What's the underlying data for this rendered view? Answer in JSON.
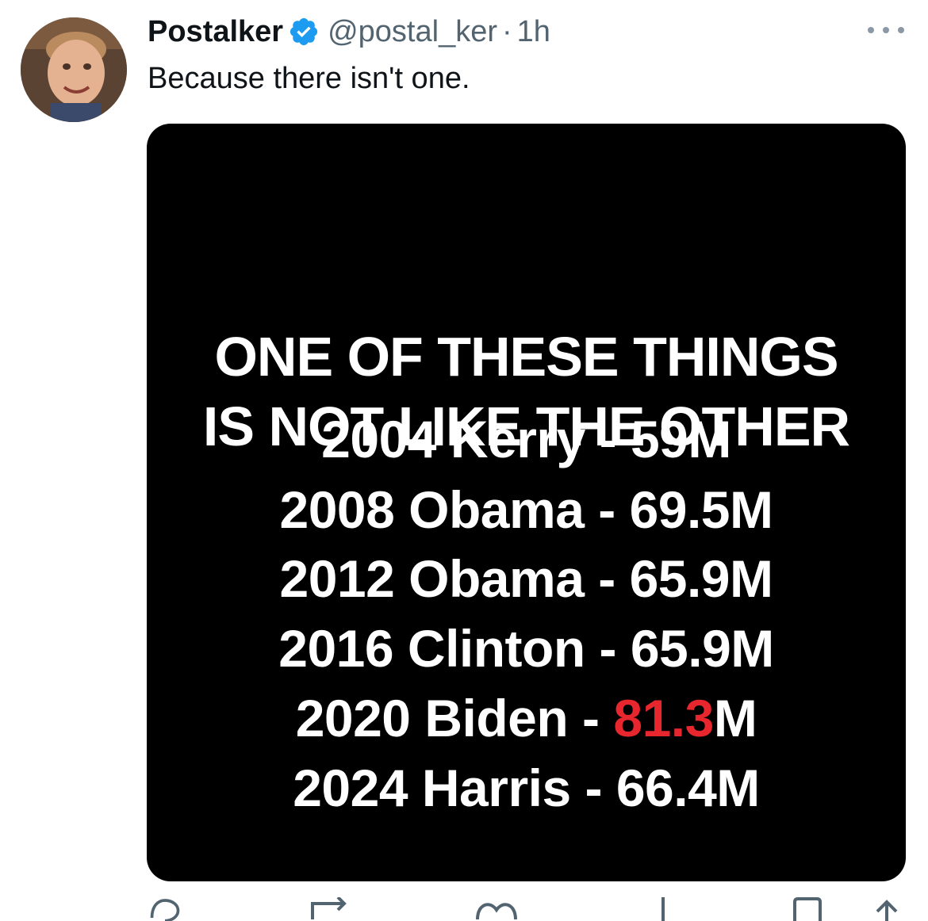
{
  "tweet": {
    "display_name": "Postalker",
    "handle": "@postal_ker",
    "separator": "·",
    "time": "1h",
    "text": "Because there isn't one."
  },
  "image": {
    "title_lines": [
      "ONE OF THESE THINGS",
      "IS NOT LIKE THE OTHER"
    ],
    "results": [
      {
        "year": "2004",
        "candidate": "Kerry",
        "votes_plain": "59M"
      },
      {
        "year": "2008",
        "candidate": "Obama",
        "votes_plain": "69.5M"
      },
      {
        "year": "2012",
        "candidate": "Obama",
        "votes_plain": "65.9M"
      },
      {
        "year": "2016",
        "candidate": "Clinton",
        "votes_plain": "65.9M"
      },
      {
        "year": "2020",
        "candidate": "Biden",
        "votes_highlight": "81.3",
        "votes_suffix": "M"
      },
      {
        "year": "2024",
        "candidate": "Harris",
        "votes_plain": "66.4M"
      }
    ],
    "highlight_color": "#e8262e"
  },
  "actions": [
    {
      "icon": "reply-icon"
    },
    {
      "icon": "retweet-icon"
    },
    {
      "icon": "like-icon"
    },
    {
      "icon": "views-icon"
    },
    {
      "icon": "bookmark-icon"
    },
    {
      "icon": "share-icon"
    }
  ],
  "colors": {
    "verified": "#1d9bf0",
    "secondary_text": "#536471"
  }
}
